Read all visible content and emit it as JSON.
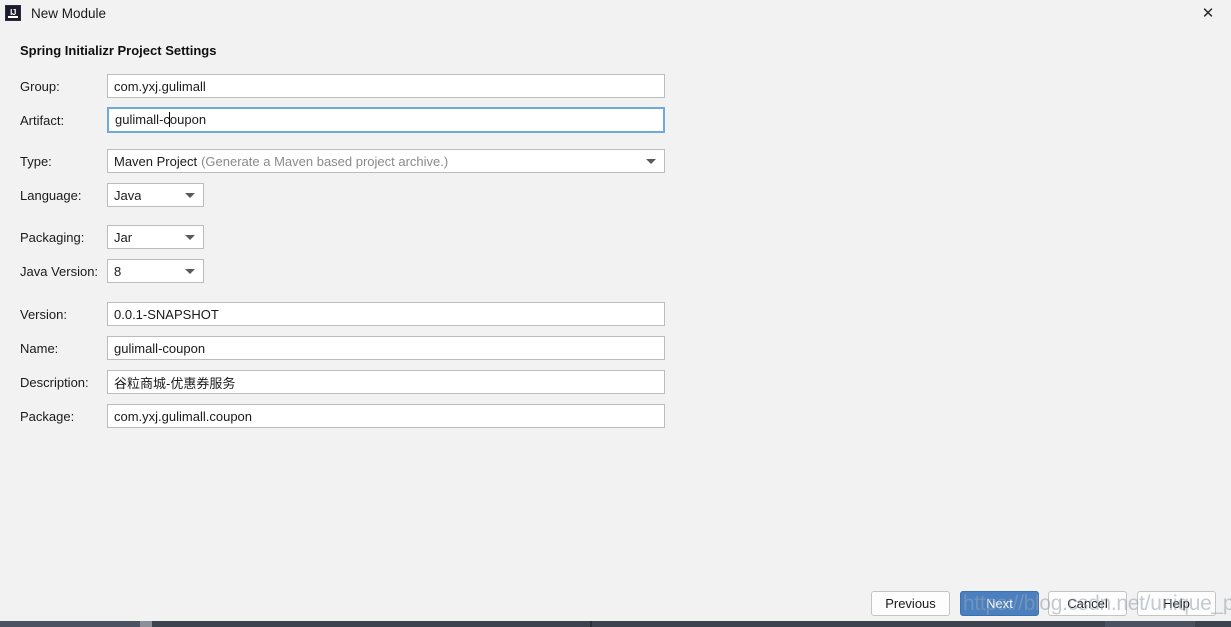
{
  "window": {
    "title": "New Module",
    "app_icon": "intellij-idea-icon",
    "close_icon": "close-icon"
  },
  "dialog": {
    "section_title": "Spring Initializr Project Settings",
    "fields": [
      {
        "key": "group",
        "label": "Group:",
        "value": "com.yxj.gulimall",
        "type": "text",
        "focused": false
      },
      {
        "key": "artifact",
        "label": "Artifact:",
        "value": "gulimall-coupon",
        "type": "text",
        "focused": true,
        "caret_after": "gulimall-c"
      },
      {
        "key": "type",
        "label": "Type:",
        "value": "Maven Project",
        "hint": "(Generate a Maven based project archive.)",
        "type": "combo",
        "width": "wide"
      },
      {
        "key": "language",
        "label": "Language:",
        "value": "Java",
        "type": "combo",
        "width": "narrow"
      },
      {
        "key": "packaging",
        "label": "Packaging:",
        "value": "Jar",
        "type": "combo",
        "width": "narrow"
      },
      {
        "key": "java_version",
        "label": "Java Version:",
        "value": "8",
        "type": "combo",
        "width": "narrow"
      },
      {
        "key": "version",
        "label": "Version:",
        "value": "0.0.1-SNAPSHOT",
        "type": "text",
        "focused": false
      },
      {
        "key": "name",
        "label": "Name:",
        "value": "gulimall-coupon",
        "type": "text",
        "focused": false
      },
      {
        "key": "description",
        "label": "Description:",
        "value": "谷粒商城-优惠券服务",
        "type": "text",
        "focused": false
      },
      {
        "key": "package",
        "label": "Package:",
        "value": "com.yxj.gulimall.coupon",
        "type": "text",
        "focused": false
      }
    ]
  },
  "footer": {
    "previous_label": "Previous",
    "next_label": "Next",
    "cancel_label": "Cancel",
    "help_label": "Help"
  },
  "watermark": {
    "text": "https://blog.csdn.net/unique_perfect"
  },
  "colors": {
    "background": "#f2f2f2",
    "primary_button": "#4a80c0",
    "focus_border": "#6fa8dc",
    "input_border": "#bcbcbc",
    "taskbar": "#3d4450"
  }
}
